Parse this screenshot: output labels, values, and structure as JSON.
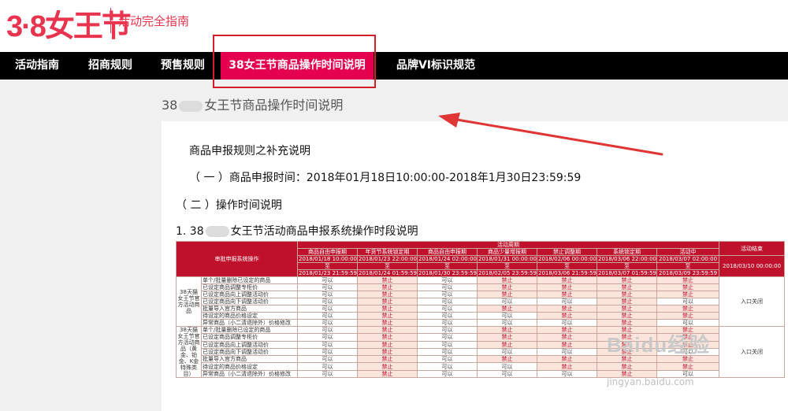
{
  "header": {
    "logo_text": "3·8女王节",
    "subtitle": "活动完全指南"
  },
  "nav": {
    "items": [
      {
        "label": "活动指南"
      },
      {
        "label": "招商规则"
      },
      {
        "label": "预售规则"
      },
      {
        "label": "38女王节商品操作时间说明"
      },
      {
        "label": "品牌VI标识规范"
      }
    ]
  },
  "page": {
    "title_prefix": "38",
    "title_suffix": "女王节商品操作时间说明",
    "heading": "商品申报规则之补充说明",
    "line1": "（ 一 ）商品申报时间：2018年01月18日10:00:00-2018年1月30日23:59:59",
    "line2": "（ 二 ）操作时间说明",
    "item1_prefix": "1.   38",
    "item1_suffix": "女王节活动商品申报系统操作时段说明"
  },
  "table": {
    "activity_period": "活动周期",
    "ops_header": "审批申报系统操作",
    "end_header": "活动结束",
    "stages": [
      {
        "name": "商品自由申报期",
        "start": "2018/01/18 10:00:00",
        "to": "至",
        "end": "2018/01/23 21:59:59"
      },
      {
        "name": "年货节系统锁定期",
        "start": "2018/01/23 22:00:00",
        "to": "至",
        "end": "2018/01/24 01:59:59"
      },
      {
        "name": "商品自由申报期",
        "start": "2018/01/24 02:00:00",
        "to": "至",
        "end": "2018/01/30 23:59:59"
      },
      {
        "name": "商品少量增报期",
        "start": "2018/01/31 00:00:00",
        "to": "至",
        "end": "2018/02/05 23:59:59"
      },
      {
        "name": "禁止调整期",
        "start": "2018/02/06 00:00:00",
        "to": "至",
        "end": "2018/03/06 21:59:59"
      },
      {
        "name": "系统锁定期",
        "start": "2018/03/06 22:00:00",
        "to": "至",
        "end": "2018/03/07 01:59:59"
      },
      {
        "name": "活动中",
        "start": "2018/03/07 02:00:00",
        "to": "至",
        "end": "2018/03/09 23:59:59"
      }
    ],
    "end_date": "2018/03/10 00:00:00",
    "groups": [
      {
        "category": "38天猫女王节官方活动商品",
        "close_label": "入口关闭",
        "rows": [
          {
            "op": "单个/批量删除已设定的商品",
            "cells": [
              "可以",
              "禁止",
              "可以",
              "禁止",
              "禁止",
              "禁止",
              "禁止"
            ]
          },
          {
            "op": "已设定商品调整专柜价",
            "cells": [
              "可以",
              "禁止",
              "可以",
              "禁止",
              "禁止",
              "禁止",
              "禁止"
            ]
          },
          {
            "op": "已设定商品向上调整活动价",
            "cells": [
              "可以",
              "禁止",
              "可以",
              "禁止",
              "禁止",
              "禁止",
              "禁止"
            ]
          },
          {
            "op": "已设定商品向下调整活动价",
            "cells": [
              "可以",
              "禁止",
              "可以",
              "可以",
              "可以",
              "禁止",
              "可以"
            ]
          },
          {
            "op": "批量导入官方商品",
            "cells": [
              "可以",
              "禁止",
              "可以",
              "禁止",
              "禁止",
              "禁止",
              "禁止"
            ]
          },
          {
            "op": "待设定的商品价格设定",
            "cells": [
              "可以",
              "禁止",
              "可以",
              "可以",
              "禁止",
              "禁止",
              "禁止"
            ]
          },
          {
            "op": "异常商品（小二清退除外）价格修改",
            "cells": [
              "可以",
              "禁止",
              "可以",
              "可以",
              "可以",
              "禁止",
              "可以"
            ]
          }
        ]
      },
      {
        "category": "38天猫女王节官方活动商品（黄金、铂金、K金特殊类目）",
        "close_label": "入口关闭",
        "rows": [
          {
            "op": "单个/批量删除已设定的商品",
            "cells": [
              "可以",
              "禁止",
              "可以",
              "禁止",
              "禁止",
              "禁止",
              "禁止"
            ]
          },
          {
            "op": "已设定商品调整专柜价",
            "cells": [
              "可以",
              "禁止",
              "可以",
              "禁止",
              "禁止",
              "禁止",
              "禁止"
            ]
          },
          {
            "op": "已设定商品向上调整活动价",
            "cells": [
              "可以",
              "禁止",
              "可以",
              "禁止",
              "禁止",
              "禁止",
              "禁止"
            ]
          },
          {
            "op": "已设定商品向下调整活动价",
            "cells": [
              "可以",
              "禁止",
              "可以",
              "可以",
              "可以",
              "禁止",
              "可以"
            ]
          },
          {
            "op": "批量导入官方商品",
            "cells": [
              "可以",
              "禁止",
              "可以",
              "禁止",
              "禁止",
              "禁止",
              "禁止"
            ]
          },
          {
            "op": "待设定的商品价格设定",
            "cells": [
              "可以",
              "禁止",
              "可以",
              "可以",
              "禁止",
              "禁止",
              "禁止"
            ]
          },
          {
            "op": "异常商品（小二清退除外）价格修改",
            "cells": [
              "可以",
              "禁止",
              "可以",
              "可以",
              "可以",
              "禁止",
              "可以"
            ]
          }
        ]
      }
    ]
  },
  "watermark": {
    "logo": "Baidu经验",
    "url": "jingyan.baidu.com"
  },
  "colors": {
    "brand": "#e8344e",
    "nav_active": "#e5004f",
    "table_header": "#c0112c",
    "annotation": "#d21e2b"
  }
}
